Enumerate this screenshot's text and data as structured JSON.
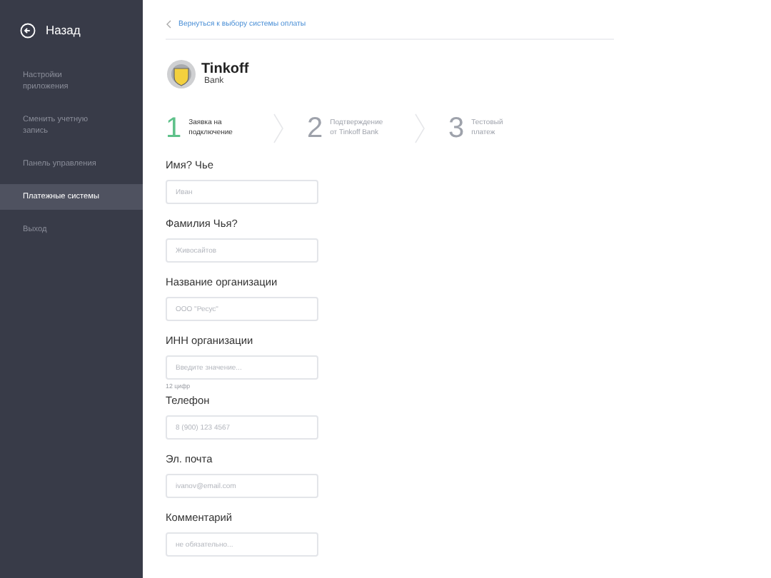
{
  "sidebar": {
    "back": "Назад",
    "items": [
      {
        "label": "Настройки приложения",
        "selected": false
      },
      {
        "label": "Сменить учетную запись",
        "selected": false
      },
      {
        "label": "Панель управления",
        "selected": false
      },
      {
        "label": "Платежные системы",
        "selected": true
      },
      {
        "label": "Выход",
        "selected": false
      }
    ]
  },
  "back_link": "Вернуться к выбору системы оплаты",
  "logo": {
    "name": "Tinkoff",
    "sub": "Bank"
  },
  "steps": [
    {
      "number": "1",
      "label": "Заявка на подключение",
      "active": true
    },
    {
      "number": "2",
      "label": "Подтверждение от Tinkoff Bank",
      "active": false
    },
    {
      "number": "3",
      "label": "Тестовый платеж",
      "active": false
    }
  ],
  "fields": [
    {
      "label": "Имя? Чье",
      "placeholder": "Иван"
    },
    {
      "label": "Фамилия Чья?",
      "placeholder": "Живосайтов"
    },
    {
      "label": "Название организации",
      "placeholder": "ООО \"Ресус\""
    },
    {
      "label": "ИНН организации",
      "placeholder": "Введите значение...",
      "hint": "12 цифр"
    },
    {
      "label": "Телефон",
      "placeholder": "8 (900) 123 4567"
    },
    {
      "label": "Эл. почта",
      "placeholder": "ivanov@email.com"
    },
    {
      "label": "Комментарий",
      "placeholder": "не обязательно..."
    }
  ]
}
